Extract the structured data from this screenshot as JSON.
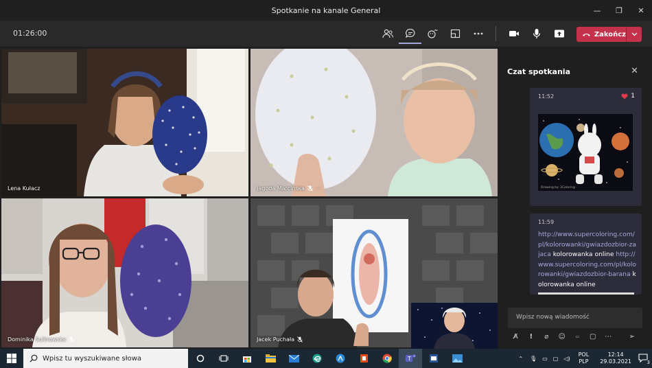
{
  "window": {
    "title": "Spotkanie na kanale General"
  },
  "toolbar": {
    "timer": "01:26:00",
    "end_label": "Zakończ"
  },
  "participants": [
    {
      "name": "Lena Kułacz",
      "muted": false
    },
    {
      "name": "Jagoda Marcińska",
      "muted": true,
      "more": "⋯"
    },
    {
      "name": "Dominika Sulinowska",
      "muted": true
    },
    {
      "name": "Jacek Puchała",
      "muted": true
    }
  ],
  "chat": {
    "title": "Czat spotkania",
    "messages": [
      {
        "time": "11:52",
        "reaction_count": "1",
        "image_caption": "Drawing by: 2Coloring"
      },
      {
        "time": "11:59",
        "parts": [
          {
            "text": "http://www.supercoloring.com/pl/kolorowanki/gwiazdozbior-zajaca",
            "type": "link"
          },
          {
            "text": "kolorowanka online",
            "type": "text"
          },
          {
            "text": "http://www.supercoloring.com/pl/kolorowanki/gwiazdozbior-barana",
            "type": "link"
          },
          {
            "text": "kolorowanka online",
            "type": "text"
          }
        ]
      }
    ],
    "compose_placeholder": "Wpisz nową wiadomość"
  },
  "taskbar": {
    "search_placeholder": "Wpisz tu wyszukiwane słowa",
    "lang_top": "POL",
    "lang_bottom": "PLP",
    "time": "12:14",
    "date": "29.03.2021",
    "notification_count": "3"
  },
  "colors": {
    "accent": "#6264a7",
    "end_call": "#c4314b",
    "taskbar": "#1b2733"
  }
}
